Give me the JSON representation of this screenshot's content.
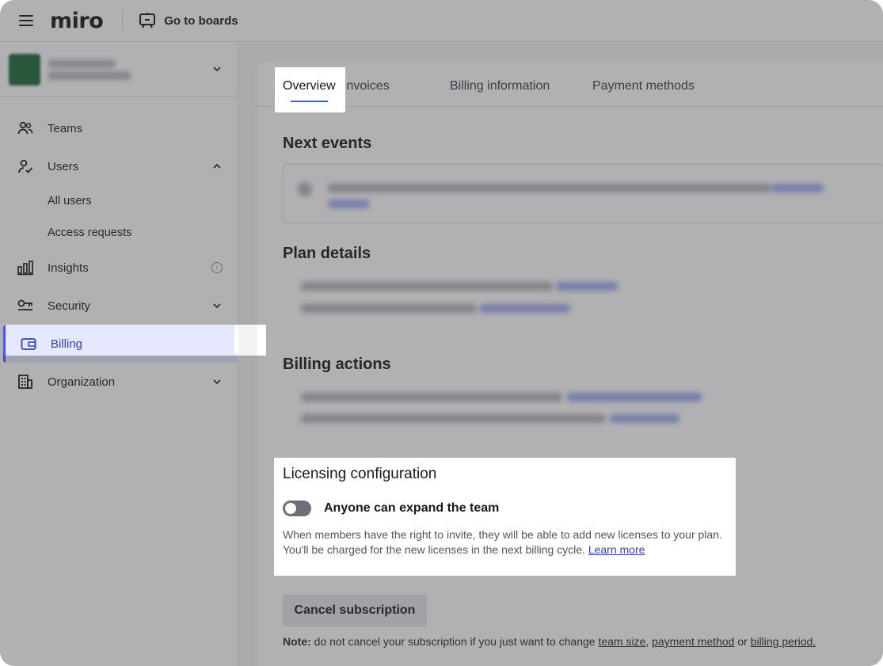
{
  "topbar": {
    "logo": "miro",
    "goto_boards": "Go to boards"
  },
  "sidebar": {
    "items": [
      {
        "label": "Teams",
        "icon": "users-icon"
      },
      {
        "label": "Users",
        "icon": "user-check-icon"
      },
      {
        "label": "All users"
      },
      {
        "label": "Access requests"
      },
      {
        "label": "Insights",
        "icon": "bar-chart-icon"
      },
      {
        "label": "Security",
        "icon": "key-icon"
      },
      {
        "label": "Billing",
        "icon": "wallet-icon"
      },
      {
        "label": "Organization",
        "icon": "building-icon"
      }
    ]
  },
  "tabs": [
    "Overview",
    "Invoices",
    "Billing information",
    "Payment methods"
  ],
  "sections": {
    "next_events": "Next events",
    "plan_details": "Plan details",
    "billing_actions": "Billing actions"
  },
  "licensing": {
    "title": "Licensing configuration",
    "toggle_label": "Anyone can expand the team",
    "toggle_on": false,
    "description": "When members have the right to invite, they will be able to add new licenses to your plan. You'll be charged for the new licenses in the next billing cycle.",
    "learn_more": "Learn more"
  },
  "cancel_button": "Cancel subscription",
  "note": {
    "prefix": "Note:",
    "text": "do not cancel your subscription if you just want to change",
    "link_team_size": "team size",
    "comma": ",",
    "link_payment_method": "payment method",
    "or": "or",
    "link_billing_period": "billing period."
  },
  "colors": {
    "accent": "#4255ff",
    "active_bg": "#e6e8fd",
    "org_avatar": "#1b6a38"
  }
}
